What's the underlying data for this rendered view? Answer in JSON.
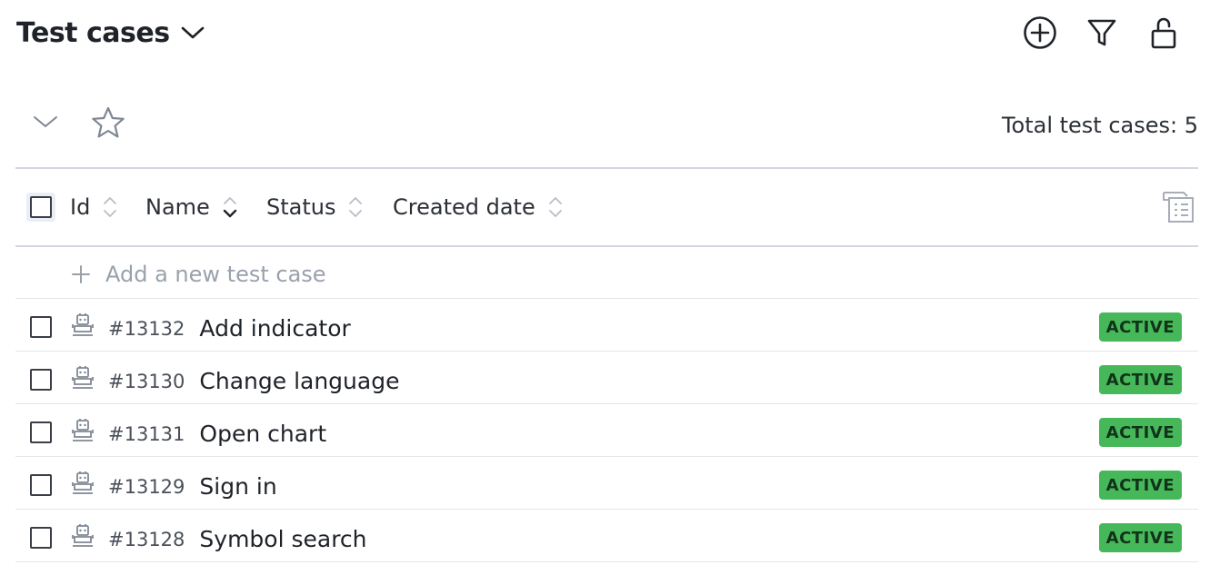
{
  "header": {
    "title": "Test cases"
  },
  "toolbar": {
    "total_label": "Total test cases: 5"
  },
  "table": {
    "columns": [
      {
        "label": "Id"
      },
      {
        "label": "Name"
      },
      {
        "label": "Status"
      },
      {
        "label": "Created date"
      }
    ],
    "add_label": "Add a new test case",
    "rows": [
      {
        "id": "#13132",
        "name": "Add indicator",
        "status": "ACTIVE"
      },
      {
        "id": "#13130",
        "name": "Change language",
        "status": "ACTIVE"
      },
      {
        "id": "#13131",
        "name": "Open chart",
        "status": "ACTIVE"
      },
      {
        "id": "#13129",
        "name": "Sign in",
        "status": "ACTIVE"
      },
      {
        "id": "#13128",
        "name": "Symbol search",
        "status": "ACTIVE"
      }
    ]
  },
  "colors": {
    "active_badge": "#47b85a",
    "muted_text": "#9aa1ab",
    "divider": "#d3d8de"
  }
}
